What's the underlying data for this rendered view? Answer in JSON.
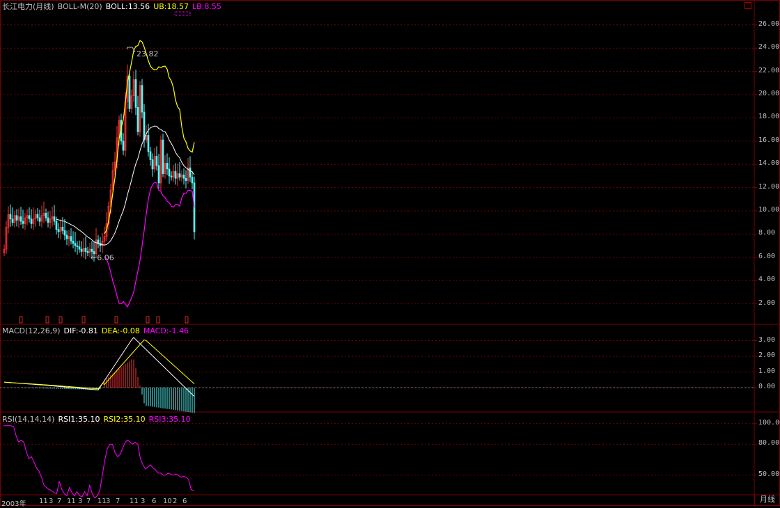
{
  "main_panel": {
    "stock_name": "长江电力(月线)",
    "indicator": "BOLL-M(20)",
    "boll_label": "BOLL:13.56",
    "ub_label": "UB:18.57",
    "lb_label": "LB:8.55",
    "high_label": "23.82",
    "low_label": "←6.06",
    "y_ticks": [
      "26.00",
      "24.00",
      "22.00",
      "20.00",
      "18.00",
      "16.00",
      "14.00",
      "12.00",
      "10.00",
      "8.00",
      "6.00",
      "4.00",
      "2.00"
    ]
  },
  "macd_panel": {
    "indicator": "MACD(12,26,9)",
    "dif_label": "DIF:-0.81",
    "dea_label": "DEA:-0.08",
    "macd_label": "MACD:-1.46",
    "y_ticks": [
      "3.00",
      "2.00",
      "1.00",
      "0.00"
    ]
  },
  "rsi_panel": {
    "indicator": "RSI(14,14,14)",
    "rsi1_label": "RSI1:35.10",
    "rsi2_label": "RSI2:35.10",
    "rsi3_label": "RSI3:35.10",
    "y_ticks": [
      "100.00",
      "80.00",
      "50.00"
    ]
  },
  "x_axis": {
    "dates": [
      "2003年",
      "11",
      "3",
      "7",
      "11",
      "3",
      "7",
      "11",
      "3",
      "7",
      "11",
      "3",
      "6",
      "10",
      "2",
      "6"
    ]
  },
  "period": "月线",
  "colors": {
    "up": "#ff3232",
    "down": "#54fcfc",
    "boll_mid": "#ffffff",
    "boll_ub": "#ffff00",
    "boll_lb": "#ff00ff",
    "grid": "#7a0000",
    "axis_text": "#c0c0c0"
  },
  "chart_data": {
    "type": "candlestick",
    "title": "长江电力(月线)",
    "price_range": [
      0,
      27
    ],
    "closes": [
      6.7,
      8.6,
      9.7,
      9.3,
      9.0,
      9.6,
      9.2,
      9.5,
      9.1,
      8.9,
      9.4,
      9.6,
      9.3,
      8.9,
      9.3,
      9.7,
      9.4,
      9.1,
      9.6,
      9.8,
      9.4,
      9.0,
      9.3,
      9.5,
      9.1,
      8.4,
      8.2,
      8.6,
      8.3,
      7.9,
      7.6,
      7.8,
      7.4,
      7.2,
      7.0,
      6.9,
      6.7,
      6.5,
      6.8,
      6.5,
      6.4,
      6.7,
      6.5,
      6.3,
      7.5,
      7.2,
      7.0,
      7.4,
      7.8,
      8.9,
      10.4,
      11.8,
      13.5,
      14.2,
      16.3,
      17.8,
      16.0,
      15.2,
      19.4,
      21.6,
      18.8,
      19.9,
      21.3,
      18.9,
      16.8,
      20.8,
      18.5,
      16.1,
      16.5,
      15.1,
      14.4,
      13.6,
      14.7,
      13.9,
      12.4,
      16.1,
      13.2,
      14.1,
      13.6,
      13.0,
      12.9,
      13.4,
      12.8,
      13.2,
      12.9,
      13.1,
      12.8,
      12.6,
      13.7,
      12.9,
      12.4,
      8.2
    ],
    "high": 23.82,
    "low": 6.06,
    "boll_mid_last": 13.56,
    "boll_ub_last": 18.57,
    "boll_lb_last": 8.55,
    "macd": {
      "dif_last": -0.81,
      "dea_last": -0.08,
      "macd_last": -1.46,
      "range": [
        -0.6,
        3.6
      ]
    },
    "rsi": {
      "values": [
        98,
        98,
        98,
        98,
        97,
        88,
        82,
        84,
        82,
        73,
        66,
        68,
        63,
        57,
        54,
        48,
        40,
        38,
        36,
        35,
        33,
        32,
        44,
        36,
        32,
        30,
        38,
        33,
        30,
        34,
        30,
        29,
        34,
        30,
        40,
        32,
        28,
        30,
        35,
        50,
        65,
        76,
        80,
        80,
        72,
        68,
        70,
        76,
        82,
        84,
        82,
        80,
        82,
        80,
        66,
        60,
        56,
        58,
        60,
        57,
        55,
        52,
        52,
        50,
        50,
        52,
        51,
        50,
        51,
        50,
        48,
        49,
        48,
        46,
        36,
        35
      ],
      "range": [
        35,
        105
      ]
    }
  }
}
